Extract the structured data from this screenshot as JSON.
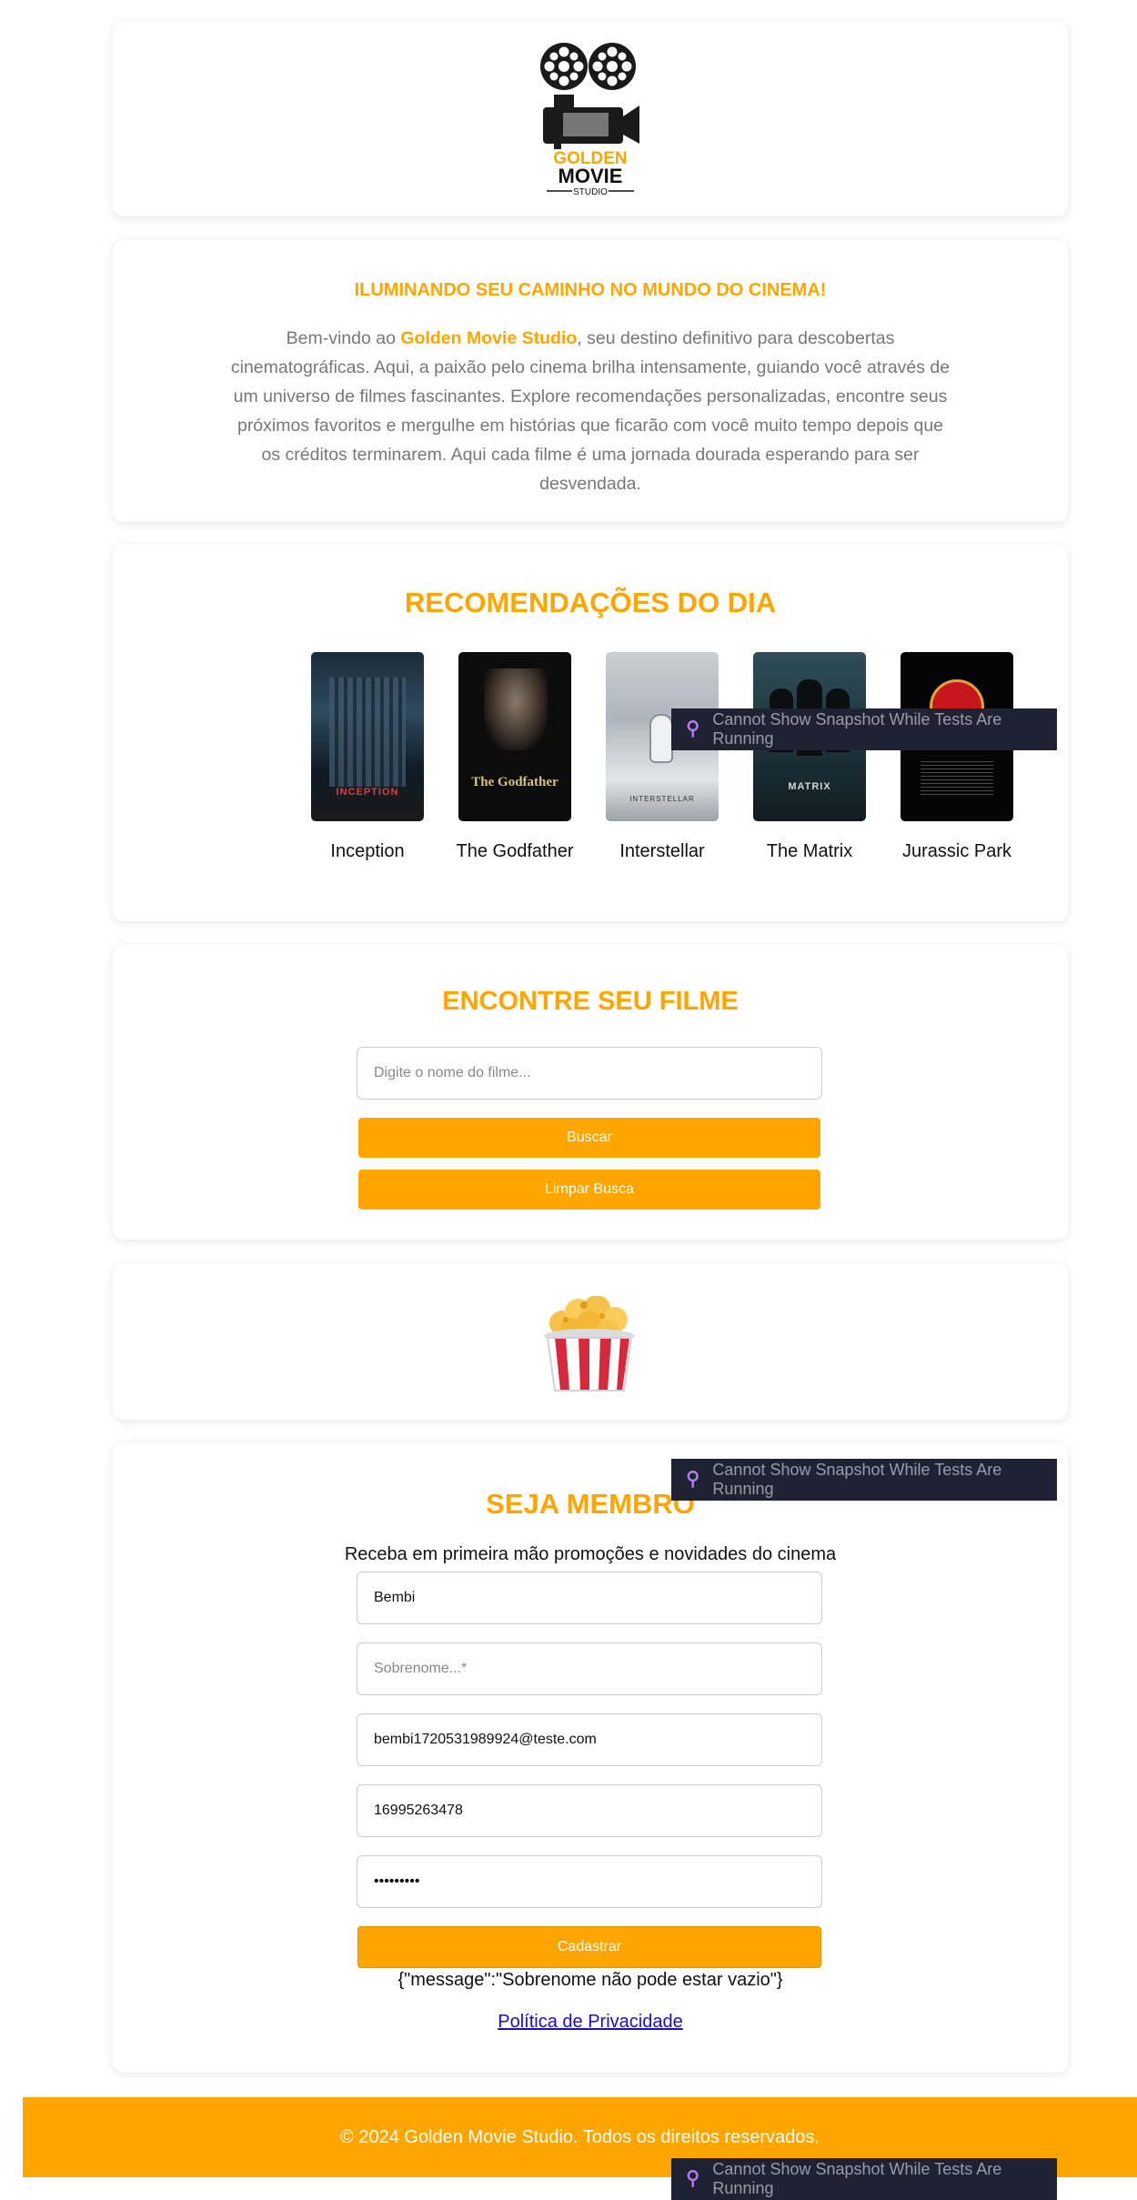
{
  "intro": {
    "title": "ILUMINANDO SEU CAMINHO NO MUNDO DO CINEMA!",
    "text_before": "Bem-vindo ao ",
    "brand": "Golden Movie Studio",
    "text_after": ", seu destino definitivo para descobertas cinematográficas. Aqui, a paixão pelo cinema brilha intensamente, guiando você através de um universo de filmes fascinantes. Explore recomendações personalizadas, encontre seus próximos favoritos e mergulhe em histórias que ficarão com você muito tempo depois que os créditos terminarem. Aqui cada filme é uma jornada dourada esperando para ser desvendada."
  },
  "logo": {
    "line1": "GOLDEN",
    "line2": "MOVIE",
    "line3": "STUDIO"
  },
  "recommendations": {
    "title": "RECOMENDAÇÕES DO DIA",
    "movies": [
      {
        "title": "Inception",
        "poster_text": "INCEPTION"
      },
      {
        "title": "The Godfather",
        "poster_text": "The Godfather"
      },
      {
        "title": "Interstellar",
        "poster_text": "INTERSTELLAR"
      },
      {
        "title": "The Matrix",
        "poster_text": "MATRIX"
      },
      {
        "title": "Jurassic Park",
        "poster_text": ""
      }
    ]
  },
  "search": {
    "title": "ENCONTRE SEU FILME",
    "placeholder": "Digite o nome do filme...",
    "value": "",
    "search_label": "Buscar",
    "clear_label": "Limpar Busca"
  },
  "member": {
    "title": "SEJA MEMBRO",
    "subtitle": "Receba em primeira mão promoções e novidades do cinema",
    "first_name": "Bembi",
    "last_name_placeholder": "Sobrenome...*",
    "last_name": "",
    "email": "bembi1720531989924@teste.com",
    "phone": "16995263478",
    "password": "123456789",
    "submit_label": "Cadastrar",
    "response": "{\"message\":\"Sobrenome não pode estar vazio\"}",
    "privacy_label": "Política de Privacidade"
  },
  "footer": {
    "text": "© 2024 Golden Movie Studio. Todos os direitos reservados."
  },
  "toasts": {
    "message": "Cannot Show Snapshot While Tests Are Running"
  },
  "colors": {
    "accent": "#ffa500",
    "toast_bg": "#1f2233",
    "link": "#1a0dcc"
  }
}
